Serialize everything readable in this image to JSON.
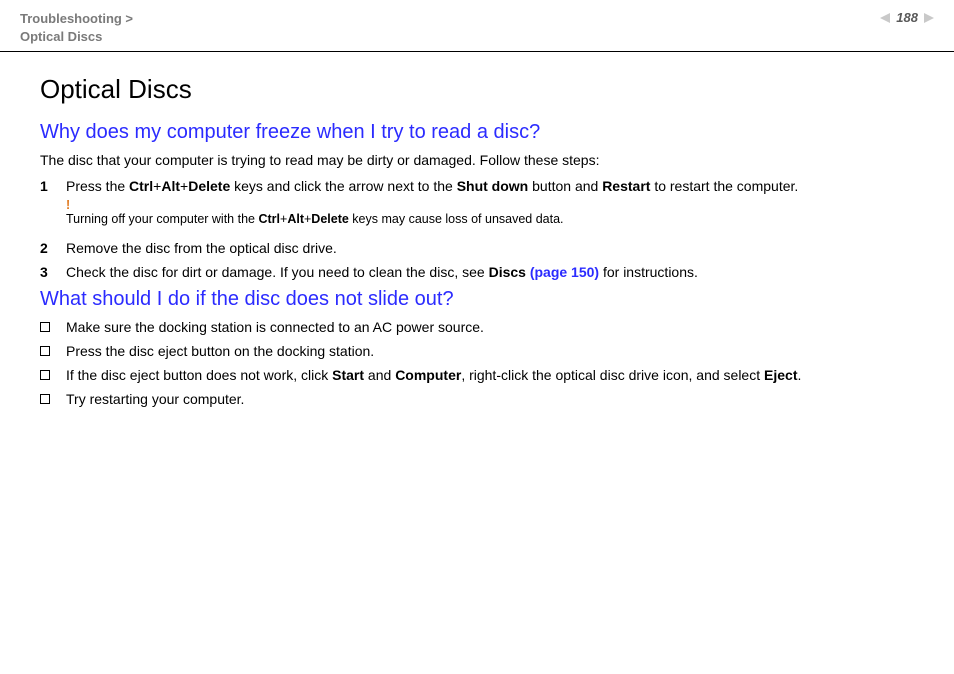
{
  "header": {
    "breadcrumb_line1": "Troubleshooting >",
    "breadcrumb_line2": "Optical Discs",
    "page_number": "188"
  },
  "title": "Optical Discs",
  "q1": {
    "heading": "Why does my computer freeze when I try to read a disc?",
    "intro": "The disc that your computer is trying to read may be dirty or damaged. Follow these steps:",
    "steps": [
      {
        "num": "1",
        "pre": "Press the ",
        "k1": "Ctrl",
        "plus1": "+",
        "k2": "Alt",
        "plus2": "+",
        "k3": "Delete",
        "mid1": " keys and click the arrow next to the ",
        "b1": "Shut down",
        "mid2": " button and ",
        "b2": "Restart",
        "post": " to restart the computer."
      },
      {
        "num": "2",
        "text": "Remove the disc from the optical disc drive."
      },
      {
        "num": "3",
        "pre": "Check the disc for dirt or damage. If you need to clean the disc, see ",
        "b1": "Discs ",
        "link": "(page 150)",
        "post": " for instructions."
      }
    ],
    "warning": {
      "bang": "!",
      "pre": "Turning off your computer with the ",
      "k1": "Ctrl",
      "plus1": "+",
      "k2": "Alt",
      "plus2": "+",
      "k3": "Delete",
      "post": " keys may cause loss of unsaved data."
    }
  },
  "q2": {
    "heading": "What should I do if the disc does not slide out?",
    "items": [
      {
        "text": "Make sure the docking station is connected to an AC power source."
      },
      {
        "text": "Press the disc eject button on the docking station."
      },
      {
        "pre": "If the disc eject button does not work, click ",
        "b1": "Start",
        "mid1": " and ",
        "b2": "Computer",
        "mid2": ", right-click the optical disc drive icon, and select ",
        "b3": "Eject",
        "post": "."
      },
      {
        "text": "Try restarting your computer."
      }
    ]
  }
}
